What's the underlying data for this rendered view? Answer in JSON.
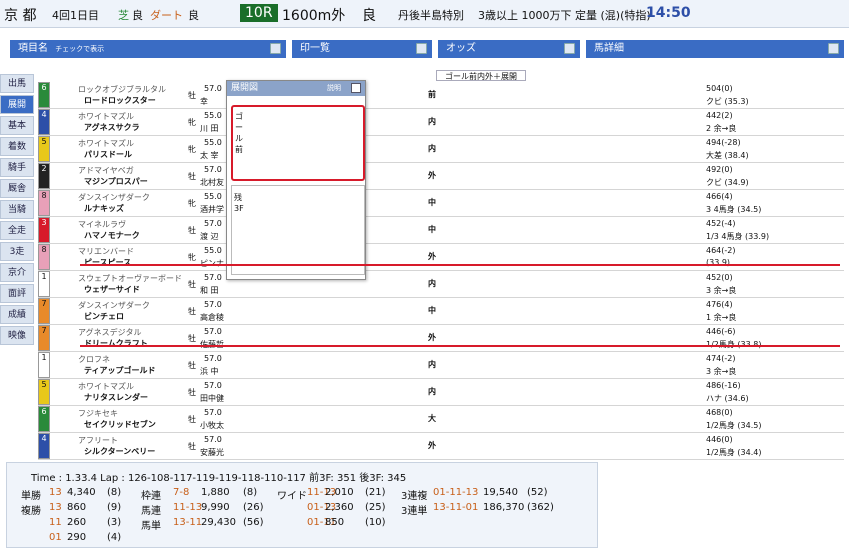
{
  "header": {
    "venue": "京 都",
    "meeting": "4回1日目",
    "turf_label": "芝",
    "turf_cond": "良",
    "dirt_label": "ダート",
    "dirt_cond": "良",
    "race_no": "10R",
    "distance": "1600m外",
    "cond": "良",
    "race_name": "丹後半島特別",
    "race_class": "3歳以上 1000万下 定量 (混)(特指)",
    "post_time": "14:50"
  },
  "columns": {
    "item": "項目名",
    "check": "チェックで表示",
    "print": "印一覧",
    "odds": "オッズ",
    "detail": "馬詳細"
  },
  "subhead": "ゴール前内外＋展開",
  "sidebar": [
    "出馬",
    "展開",
    "基本",
    "着数",
    "騎手",
    "厩舎",
    "当騎",
    "全走",
    "3走",
    "京介",
    "面評",
    "成績",
    "映像"
  ],
  "overlay": {
    "title": "展開図",
    "btn": "説明",
    "goal": "ゴール前",
    "ch": "予想",
    "chart": "残3F"
  },
  "horses": [
    {
      "frame": "6",
      "sire": "ロックオブジブラルタル",
      "name": "ロードロックスター",
      "sex": "牡",
      "wt": "57.0",
      "jockey": "幸",
      "mid": "前",
      "res": "504(0)",
      "res2": "クビ (35.3)"
    },
    {
      "frame": "4",
      "sire": "ホワイトマズル",
      "name": "アグネスサクラ",
      "sex": "牝",
      "wt": "55.0",
      "jockey": "川 田",
      "mid": "内",
      "res": "442(2)",
      "res2": "2 余→良"
    },
    {
      "frame": "5",
      "sire": "ホワイトマズル",
      "name": "パリスドール",
      "sex": "牝",
      "wt": "55.0",
      "jockey": "太 宰",
      "mid": "内",
      "res": "494(-28)",
      "res2": "大差 (38.4)"
    },
    {
      "frame": "2",
      "sire": "アドマイヤベガ",
      "name": "マジンプロスパー",
      "sex": "牡",
      "wt": "57.0",
      "jockey": "北村友",
      "mid": "外",
      "res": "492(0)",
      "res2": "クビ (34.9)"
    },
    {
      "frame": "8",
      "sire": "ダンスインザダーク",
      "name": "ルナキッズ",
      "sex": "牝",
      "wt": "55.0",
      "jockey": "酒井学",
      "mid": "中",
      "res": "466(4)",
      "res2": "3 4馬身 (34.5)"
    },
    {
      "frame": "3",
      "sire": "マイネルラヴ",
      "name": "ハマノモナーク",
      "sex": "牡",
      "wt": "57.0",
      "jockey": "渡 辺",
      "mid": "中",
      "res": "452(-4)",
      "res2": "1/3 4馬身 (33.9)"
    },
    {
      "frame": "8",
      "sire": "マリエンバード",
      "name": "ピースピース",
      "sex": "牝",
      "wt": "55.0",
      "jockey": "ピンナ",
      "mid": "外",
      "res": "464(-2)",
      "res2": "(33.9)"
    },
    {
      "frame": "1",
      "sire": "スウェプトオーヴァーボード",
      "name": "ウェザーサイド",
      "sex": "牡",
      "wt": "57.0",
      "jockey": "和 田",
      "mid": "内",
      "res": "452(0)",
      "res2": "3 余→良"
    },
    {
      "frame": "7",
      "sire": "ダンスインザダーク",
      "name": "ビンチェロ",
      "sex": "牡",
      "wt": "57.0",
      "jockey": "高倉稜",
      "mid": "中",
      "res": "476(4)",
      "res2": "1 余→良"
    },
    {
      "frame": "7",
      "sire": "アグネスデジタル",
      "name": "ドリームクラフト",
      "sex": "牡",
      "wt": "57.0",
      "jockey": "佐藤哲",
      "mid": "外",
      "res": "446(-6)",
      "res2": "1/2馬身 (33.8)"
    },
    {
      "frame": "1",
      "sire": "クロフネ",
      "name": "ティアップゴールド",
      "sex": "牡",
      "wt": "57.0",
      "jockey": "浜 中",
      "mid": "内",
      "res": "474(-2)",
      "res2": "3 余→良"
    },
    {
      "frame": "5",
      "sire": "ホワイトマズル",
      "name": "ナリタスレンダー",
      "sex": "牡",
      "wt": "57.0",
      "jockey": "田中健",
      "mid": "内",
      "res": "486(-16)",
      "res2": "ハナ (34.6)"
    },
    {
      "frame": "6",
      "sire": "フジキセキ",
      "name": "セイクリッドセブン",
      "sex": "牡",
      "wt": "57.0",
      "jockey": "小牧太",
      "mid": "大",
      "res": "468(0)",
      "res2": "1/2馬身 (34.5)"
    },
    {
      "frame": "4",
      "sire": "アフリート",
      "name": "シルクターンベリー",
      "sex": "牡",
      "wt": "57.0",
      "jockey": "安藤光",
      "mid": "外",
      "res": "446(0)",
      "res2": "1/2馬身 (34.4)"
    }
  ],
  "frame_colors": {
    "1": "#ffffff",
    "2": "#222222",
    "3": "#d71a2a",
    "4": "#2d4fa8",
    "5": "#e8c81a",
    "6": "#2a8a3a",
    "7": "#e88a2a",
    "8": "#e8a0b8"
  },
  "bottom": {
    "line1": "Time : 1.33.4  Lap : 126-108-117-119-119-118-110-117  前3F: 351  後3F: 345",
    "rows": [
      [
        "単勝",
        "13",
        "4,340",
        "(8)",
        "枠連",
        "7-8",
        "1,880",
        "(8)",
        "ワイド",
        "11-13",
        "2,010",
        "(21)",
        "3連複",
        "01-11-13",
        "19,540",
        "(52)"
      ],
      [
        "複勝",
        "13",
        "860",
        "(9)",
        "馬連",
        "11-13",
        "9,990",
        "(26)",
        "",
        "01-13",
        "2,360",
        "(25)",
        "3連単",
        "13-11-01",
        "186,370",
        "(362)"
      ],
      [
        "",
        "11",
        "260",
        "(3)",
        "馬単",
        "13-11",
        "29,430",
        "(56)",
        "",
        "01-11",
        "850",
        "(10)",
        "",
        "",
        "",
        ""
      ],
      [
        "",
        "01",
        "290",
        "(4)",
        "",
        "",
        "",
        "",
        "",
        "",
        "",
        "",
        "",
        "",
        "",
        ""
      ]
    ]
  }
}
